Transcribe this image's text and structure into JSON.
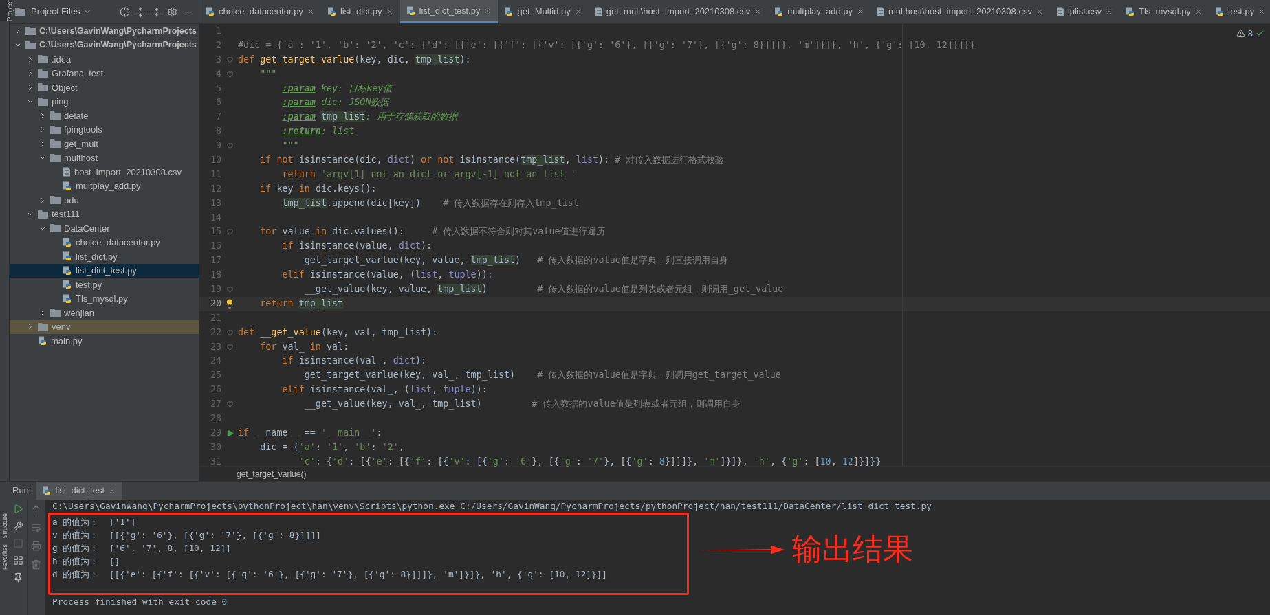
{
  "side_tabs": {
    "top": "Project",
    "bottom": [
      "Structure",
      "Favorites"
    ]
  },
  "project_panel": {
    "title": "Project Files",
    "tree": [
      {
        "label": "C:\\Users\\GavinWang\\PycharmProjects",
        "kind": "root",
        "expanded": false,
        "selected": false,
        "excluded": false
      },
      {
        "label": "C:\\Users\\GavinWang\\PycharmProjects",
        "kind": "root",
        "expanded": true,
        "selected": false,
        "excluded": false,
        "children": [
          {
            "label": ".idea",
            "kind": "folder",
            "expanded": false,
            "selected": false,
            "excluded": false
          },
          {
            "label": "Grafana_test",
            "kind": "folder",
            "expanded": false,
            "selected": false,
            "excluded": false
          },
          {
            "label": "Object",
            "kind": "folder",
            "expanded": false,
            "selected": false,
            "excluded": false
          },
          {
            "label": "ping",
            "kind": "folder",
            "expanded": true,
            "selected": false,
            "excluded": false,
            "children": [
              {
                "label": "delate",
                "kind": "folder",
                "expanded": false,
                "selected": false,
                "excluded": false
              },
              {
                "label": "fpingtools",
                "kind": "folder",
                "expanded": false,
                "selected": false,
                "excluded": false
              },
              {
                "label": "get_mult",
                "kind": "folder",
                "expanded": false,
                "selected": false,
                "excluded": false
              },
              {
                "label": "multhost",
                "kind": "folder",
                "expanded": true,
                "selected": false,
                "excluded": false,
                "children": [
                  {
                    "label": "host_import_20210308.csv",
                    "kind": "csv",
                    "selected": false,
                    "excluded": false
                  },
                  {
                    "label": "multplay_add.py",
                    "kind": "py",
                    "selected": false,
                    "excluded": false
                  }
                ]
              },
              {
                "label": "pdu",
                "kind": "folder",
                "expanded": false,
                "selected": false,
                "excluded": false
              }
            ]
          },
          {
            "label": "test111",
            "kind": "folder",
            "expanded": true,
            "selected": false,
            "excluded": false,
            "children": [
              {
                "label": "DataCenter",
                "kind": "folder",
                "expanded": true,
                "selected": false,
                "excluded": false,
                "children": [
                  {
                    "label": "choice_datacentor.py",
                    "kind": "py",
                    "selected": false,
                    "excluded": false
                  },
                  {
                    "label": "list_dict.py",
                    "kind": "py",
                    "selected": false,
                    "excluded": false
                  },
                  {
                    "label": "list_dict_test.py",
                    "kind": "py",
                    "selected": true,
                    "excluded": false
                  },
                  {
                    "label": "test.py",
                    "kind": "py",
                    "selected": false,
                    "excluded": false
                  },
                  {
                    "label": "Tls_mysql.py",
                    "kind": "py",
                    "selected": false,
                    "excluded": false
                  }
                ]
              },
              {
                "label": "wenjian",
                "kind": "folder",
                "expanded": false,
                "selected": false,
                "excluded": false
              }
            ]
          },
          {
            "label": "venv",
            "kind": "folder",
            "expanded": false,
            "selected": false,
            "excluded": true
          },
          {
            "label": "main.py",
            "kind": "py",
            "selected": false,
            "excluded": false
          }
        ]
      }
    ]
  },
  "editor_tabs": [
    {
      "label": "choice_datacentor.py",
      "kind": "py",
      "selected": false
    },
    {
      "label": "list_dict.py",
      "kind": "py",
      "selected": false
    },
    {
      "label": "list_dict_test.py",
      "kind": "py",
      "selected": true
    },
    {
      "label": "get_Multid.py",
      "kind": "py",
      "selected": false
    },
    {
      "label": "get_mult\\host_import_20210308.csv",
      "kind": "csv",
      "selected": false
    },
    {
      "label": "multplay_add.py",
      "kind": "py",
      "selected": false
    },
    {
      "label": "multhost\\host_import_20210308.csv",
      "kind": "csv",
      "selected": false
    },
    {
      "label": "iplist.csv",
      "kind": "csv",
      "selected": false
    },
    {
      "label": "Tls_mysql.py",
      "kind": "py",
      "selected": false
    },
    {
      "label": "test.py",
      "kind": "py",
      "selected": false
    }
  ],
  "editor": {
    "warnings": "8",
    "lines": [
      {
        "number": "1",
        "kind": "plain",
        "current": false
      },
      {
        "number": "2",
        "kind": "plain",
        "current": false,
        "segs": [
          {
            "kind": "comment",
            "text": "#dic = {'a': '1', 'b': '2', 'c': {'d': [{'e': [{'f': [{'v': [{'g': '6'}, [{'g': '7'}, [{'g': 8}]]]}, 'm']}]}, 'h', {'g': [10, 12]}]}}"
          }
        ]
      },
      {
        "number": "3",
        "kind": "fold",
        "current": false,
        "segs": [
          {
            "kind": "keyword",
            "text": "def "
          },
          {
            "kind": "defname",
            "text": "get_target_varlue"
          },
          {
            "kind": "plain",
            "text": "(key, dic, "
          },
          {
            "kind": "usage",
            "text": "tmp_list"
          },
          {
            "kind": "plain",
            "text": "):"
          }
        ]
      },
      {
        "number": "4",
        "kind": "fold",
        "current": false,
        "segs": [
          {
            "kind": "doc",
            "text": "    \"\"\""
          }
        ]
      },
      {
        "number": "5",
        "kind": "plain",
        "current": false,
        "segs": [
          {
            "kind": "doctag",
            "text": "        :param"
          },
          {
            "kind": "doc",
            "text": " key: 目标key值"
          }
        ]
      },
      {
        "number": "6",
        "kind": "plain",
        "current": false,
        "segs": [
          {
            "kind": "doctag",
            "text": "        :param"
          },
          {
            "kind": "doc",
            "text": " dic: JSON数据"
          }
        ]
      },
      {
        "number": "7",
        "kind": "plain",
        "current": false,
        "segs": [
          {
            "kind": "doctag",
            "text": "        :param"
          },
          {
            "kind": "usage",
            "text": " tmp_list"
          },
          {
            "kind": "doc",
            "text": ": 用于存储获取的数据"
          }
        ]
      },
      {
        "number": "8",
        "kind": "plain",
        "current": false,
        "segs": [
          {
            "kind": "doctag",
            "text": "        :return"
          },
          {
            "kind": "doc",
            "text": ": list"
          }
        ]
      },
      {
        "number": "9",
        "kind": "fold",
        "current": false,
        "segs": [
          {
            "kind": "doc",
            "text": "        \"\"\""
          }
        ]
      },
      {
        "number": "10",
        "kind": "plain",
        "current": false,
        "segs": [
          {
            "kind": "keyword",
            "text": "    if not "
          },
          {
            "kind": "plain",
            "text": "isinstance(dic, "
          },
          {
            "kind": "builtin",
            "text": "dict"
          },
          {
            "kind": "plain",
            "text": ") "
          },
          {
            "kind": "keyword",
            "text": "or not "
          },
          {
            "kind": "plain",
            "text": "isinstance("
          },
          {
            "kind": "usage",
            "text": "tmp_list"
          },
          {
            "kind": "plain",
            "text": ", "
          },
          {
            "kind": "builtin",
            "text": "list"
          },
          {
            "kind": "plain",
            "text": "): "
          },
          {
            "kind": "comment",
            "text": "# 对传入数据进行格式校验"
          }
        ]
      },
      {
        "number": "11",
        "kind": "plain",
        "current": false,
        "segs": [
          {
            "kind": "keyword",
            "text": "        return "
          },
          {
            "kind": "string",
            "text": "'argv[1] not an dict or argv[-1] not an list '"
          }
        ]
      },
      {
        "number": "12",
        "kind": "plain",
        "current": false,
        "segs": [
          {
            "kind": "keyword",
            "text": "    if "
          },
          {
            "kind": "plain",
            "text": "key "
          },
          {
            "kind": "keyword",
            "text": "in "
          },
          {
            "kind": "plain",
            "text": "dic.keys():"
          }
        ]
      },
      {
        "number": "13",
        "kind": "plain",
        "current": false,
        "segs": [
          {
            "kind": "usage",
            "text": "        tmp_list"
          },
          {
            "kind": "plain",
            "text": ".append(dic[key])    "
          },
          {
            "kind": "comment",
            "text": "# 传入数据存在则存入tmp_list"
          }
        ]
      },
      {
        "number": "14",
        "kind": "plain",
        "current": false
      },
      {
        "number": "15",
        "kind": "fold",
        "current": false,
        "segs": [
          {
            "kind": "keyword",
            "text": "    for "
          },
          {
            "kind": "plain",
            "text": "value "
          },
          {
            "kind": "keyword",
            "text": "in "
          },
          {
            "kind": "plain",
            "text": "dic.values():     "
          },
          {
            "kind": "comment",
            "text": "# 传入数据不符合则对其value值进行遍历"
          }
        ]
      },
      {
        "number": "16",
        "kind": "plain",
        "current": false,
        "segs": [
          {
            "kind": "keyword",
            "text": "        if "
          },
          {
            "kind": "plain",
            "text": "isinstance(value, "
          },
          {
            "kind": "builtin",
            "text": "dict"
          },
          {
            "kind": "plain",
            "text": "):"
          }
        ]
      },
      {
        "number": "17",
        "kind": "plain",
        "current": false,
        "segs": [
          {
            "kind": "plain",
            "text": "            get_target_varlue(key, value, "
          },
          {
            "kind": "usage",
            "text": "tmp_list"
          },
          {
            "kind": "plain",
            "text": ")   "
          },
          {
            "kind": "comment",
            "text": "# 传入数据的value值是字典，则直接调用自身"
          }
        ]
      },
      {
        "number": "18",
        "kind": "plain",
        "current": false,
        "segs": [
          {
            "kind": "keyword",
            "text": "        elif "
          },
          {
            "kind": "plain",
            "text": "isinstance(value, ("
          },
          {
            "kind": "builtin",
            "text": "list"
          },
          {
            "kind": "plain",
            "text": ", "
          },
          {
            "kind": "builtin",
            "text": "tuple"
          },
          {
            "kind": "plain",
            "text": ")):"
          }
        ]
      },
      {
        "number": "19",
        "kind": "fold",
        "current": false,
        "segs": [
          {
            "kind": "plain",
            "text": "            __get_value(key, value, "
          },
          {
            "kind": "usage",
            "text": "tmp_list"
          },
          {
            "kind": "plain",
            "text": ")         "
          },
          {
            "kind": "comment",
            "text": "# 传入数据的value值是列表或者元组，则调用_get_value"
          }
        ]
      },
      {
        "number": "20",
        "kind": "bulb",
        "current": true,
        "segs": [
          {
            "kind": "keyword",
            "text": "    return "
          },
          {
            "kind": "usage",
            "text": "tmp_list"
          }
        ]
      },
      {
        "number": "21",
        "kind": "plain",
        "current": false
      },
      {
        "number": "22",
        "kind": "fold",
        "current": false,
        "segs": [
          {
            "kind": "keyword",
            "text": "def "
          },
          {
            "kind": "defname",
            "text": "__get_value"
          },
          {
            "kind": "plain",
            "text": "(key, val, tmp_list):"
          }
        ]
      },
      {
        "number": "23",
        "kind": "fold",
        "current": false,
        "segs": [
          {
            "kind": "keyword",
            "text": "    for "
          },
          {
            "kind": "plain",
            "text": "val_ "
          },
          {
            "kind": "keyword",
            "text": "in "
          },
          {
            "kind": "plain",
            "text": "val:"
          }
        ]
      },
      {
        "number": "24",
        "kind": "plain",
        "current": false,
        "segs": [
          {
            "kind": "keyword",
            "text": "        if "
          },
          {
            "kind": "plain",
            "text": "isinstance(val_, "
          },
          {
            "kind": "builtin",
            "text": "dict"
          },
          {
            "kind": "plain",
            "text": "):"
          }
        ]
      },
      {
        "number": "25",
        "kind": "plain",
        "current": false,
        "segs": [
          {
            "kind": "plain",
            "text": "            get_target_varlue(key, val_, tmp_list)    "
          },
          {
            "kind": "comment",
            "text": "# 传入数据的value值是字典，则调用get_target_value"
          }
        ]
      },
      {
        "number": "26",
        "kind": "plain",
        "current": false,
        "segs": [
          {
            "kind": "keyword",
            "text": "        elif "
          },
          {
            "kind": "plain",
            "text": "isinstance(val_, ("
          },
          {
            "kind": "builtin",
            "text": "list"
          },
          {
            "kind": "plain",
            "text": ", "
          },
          {
            "kind": "builtin",
            "text": "tuple"
          },
          {
            "kind": "plain",
            "text": ")):"
          }
        ]
      },
      {
        "number": "27",
        "kind": "fold",
        "current": false,
        "segs": [
          {
            "kind": "plain",
            "text": "            __get_value(key, val_, tmp_list)         "
          },
          {
            "kind": "comment",
            "text": "# 传入数据的value值是列表或者元组，则调用自身"
          }
        ]
      },
      {
        "number": "28",
        "kind": "plain",
        "current": false
      },
      {
        "number": "29",
        "kind": "run",
        "current": false,
        "segs": [
          {
            "kind": "keyword",
            "text": "if "
          },
          {
            "kind": "plain",
            "text": "__name__ == "
          },
          {
            "kind": "string",
            "text": "'__main__'"
          },
          {
            "kind": "plain",
            "text": ":"
          }
        ]
      },
      {
        "number": "30",
        "kind": "plain",
        "current": false,
        "segs": [
          {
            "kind": "plain",
            "text": "    dic = {"
          },
          {
            "kind": "string",
            "text": "'a'"
          },
          {
            "kind": "plain",
            "text": ": "
          },
          {
            "kind": "string",
            "text": "'1'"
          },
          {
            "kind": "plain",
            "text": ", "
          },
          {
            "kind": "string",
            "text": "'b'"
          },
          {
            "kind": "plain",
            "text": ": "
          },
          {
            "kind": "string",
            "text": "'2'"
          },
          {
            "kind": "plain",
            "text": ","
          }
        ]
      },
      {
        "number": "31",
        "kind": "plain",
        "current": false,
        "segs": [
          {
            "kind": "string",
            "text": "           'c'"
          },
          {
            "kind": "plain",
            "text": ": {"
          },
          {
            "kind": "string",
            "text": "'d'"
          },
          {
            "kind": "plain",
            "text": ": [{"
          },
          {
            "kind": "string",
            "text": "'e'"
          },
          {
            "kind": "plain",
            "text": ": [{"
          },
          {
            "kind": "string",
            "text": "'f'"
          },
          {
            "kind": "plain",
            "text": ": [{"
          },
          {
            "kind": "string",
            "text": "'v'"
          },
          {
            "kind": "plain",
            "text": ": [{"
          },
          {
            "kind": "string",
            "text": "'g'"
          },
          {
            "kind": "plain",
            "text": ": "
          },
          {
            "kind": "string",
            "text": "'6'"
          },
          {
            "kind": "plain",
            "text": "}, [{"
          },
          {
            "kind": "string",
            "text": "'g'"
          },
          {
            "kind": "plain",
            "text": ": "
          },
          {
            "kind": "string",
            "text": "'7'"
          },
          {
            "kind": "plain",
            "text": "}, [{"
          },
          {
            "kind": "string",
            "text": "'g'"
          },
          {
            "kind": "plain",
            "text": ": "
          },
          {
            "kind": "number",
            "text": "8"
          },
          {
            "kind": "plain",
            "text": "}]]]}, "
          },
          {
            "kind": "string",
            "text": "'m'"
          },
          {
            "kind": "plain",
            "text": "]}]}, "
          },
          {
            "kind": "string",
            "text": "'h'"
          },
          {
            "kind": "plain",
            "text": ", {"
          },
          {
            "kind": "string",
            "text": "'g'"
          },
          {
            "kind": "plain",
            "text": ": ["
          },
          {
            "kind": "number",
            "text": "10"
          },
          {
            "kind": "plain",
            "text": ", "
          },
          {
            "kind": "number",
            "text": "12"
          },
          {
            "kind": "plain",
            "text": "]}]}}"
          }
        ]
      }
    ],
    "breadcrumb": "get_target_varlue()"
  },
  "run_panel": {
    "label": "Run:",
    "tab": "list_dict_test",
    "command": "C:\\Users\\GavinWang\\PycharmProjects\\pythonProject\\han\\venv\\Scripts\\python.exe C:/Users/GavinWang/PycharmProjects/pythonProject/han/test111/DataCenter/list_dict_test.py",
    "results": [
      "a 的值为：  ['1']",
      "v 的值为：  [[{'g': '6'}, [{'g': '7'}, [{'g': 8}]]]]",
      "g 的值为：  ['6', '7', 8, [10, 12]]",
      "h 的值为：  []",
      "d 的值为：  [[{'e': [{'f': [{'v': [{'g': '6'}, [{'g': '7'}, [{'g': 8}]]]}, 'm']}]}, 'h', {'g': [10, 12]}]]"
    ],
    "exit_message": "Process finished with exit code 0"
  },
  "annotation": {
    "label": "输出结果"
  }
}
